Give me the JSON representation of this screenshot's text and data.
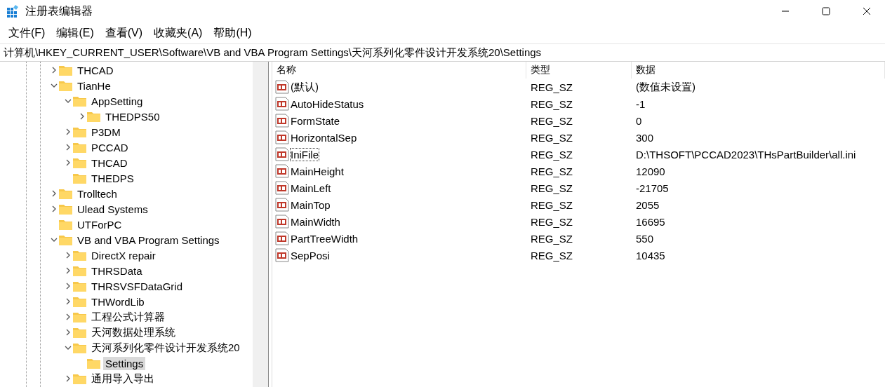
{
  "window": {
    "title": "注册表编辑器"
  },
  "menu": [
    "文件(F)",
    "编辑(E)",
    "查看(V)",
    "收藏夹(A)",
    "帮助(H)"
  ],
  "address": "计算机\\HKEY_CURRENT_USER\\Software\\VB and VBA Program Settings\\天河系列化零件设计开发系统20\\Settings",
  "tree": [
    {
      "label": "THCAD",
      "kind": "collapsed",
      "selected": false
    },
    {
      "label": "TianHe",
      "kind": "expanded",
      "selected": false,
      "children": [
        {
          "label": "AppSetting",
          "kind": "expanded",
          "selected": false,
          "children": [
            {
              "label": "THEDPS50",
              "kind": "collapsed",
              "selected": false
            }
          ]
        },
        {
          "label": "P3DM",
          "kind": "collapsed",
          "selected": false
        },
        {
          "label": "PCCAD",
          "kind": "collapsed",
          "selected": false
        },
        {
          "label": "THCAD",
          "kind": "collapsed",
          "selected": false
        },
        {
          "label": "THEDPS",
          "kind": "leaf",
          "selected": false
        }
      ]
    },
    {
      "label": "Trolltech",
      "kind": "collapsed",
      "selected": false
    },
    {
      "label": "Ulead Systems",
      "kind": "collapsed",
      "selected": false
    },
    {
      "label": "UTForPC",
      "kind": "leaf",
      "selected": false
    },
    {
      "label": "VB and VBA Program Settings",
      "kind": "expanded",
      "selected": false,
      "children": [
        {
          "label": "DirectX repair",
          "kind": "collapsed",
          "selected": false
        },
        {
          "label": "THRSData",
          "kind": "collapsed",
          "selected": false
        },
        {
          "label": "THRSVSFDataGrid",
          "kind": "collapsed",
          "selected": false
        },
        {
          "label": "THWordLib",
          "kind": "collapsed",
          "selected": false
        },
        {
          "label": "工程公式计算器",
          "kind": "collapsed",
          "selected": false
        },
        {
          "label": "天河数据处理系统",
          "kind": "collapsed",
          "selected": false
        },
        {
          "label": "天河系列化零件设计开发系统20",
          "kind": "expanded",
          "selected": false,
          "children": [
            {
              "label": "Settings",
              "kind": "leaf",
              "selected": true
            }
          ]
        },
        {
          "label": "通用导入导出",
          "kind": "collapsed",
          "selected": false
        }
      ]
    }
  ],
  "table": {
    "columns": [
      "名称",
      "类型",
      "数据"
    ],
    "rows": [
      {
        "name": "(默认)",
        "type": "REG_SZ",
        "data": "(数值未设置)",
        "focused": false
      },
      {
        "name": "AutoHideStatus",
        "type": "REG_SZ",
        "data": "-1",
        "focused": false
      },
      {
        "name": "FormState",
        "type": "REG_SZ",
        "data": "0",
        "focused": false
      },
      {
        "name": "HorizontalSep",
        "type": "REG_SZ",
        "data": "300",
        "focused": false
      },
      {
        "name": "IniFile",
        "type": "REG_SZ",
        "data": "D:\\THSOFT\\PCCAD2023\\THsPartBuilder\\all.ini",
        "focused": true
      },
      {
        "name": "MainHeight",
        "type": "REG_SZ",
        "data": "12090",
        "focused": false
      },
      {
        "name": "MainLeft",
        "type": "REG_SZ",
        "data": "-21705",
        "focused": false
      },
      {
        "name": "MainTop",
        "type": "REG_SZ",
        "data": "2055",
        "focused": false
      },
      {
        "name": "MainWidth",
        "type": "REG_SZ",
        "data": "16695",
        "focused": false
      },
      {
        "name": "PartTreeWidth",
        "type": "REG_SZ",
        "data": "550",
        "focused": false
      },
      {
        "name": "SepPosi",
        "type": "REG_SZ",
        "data": "10435",
        "focused": false
      }
    ]
  }
}
